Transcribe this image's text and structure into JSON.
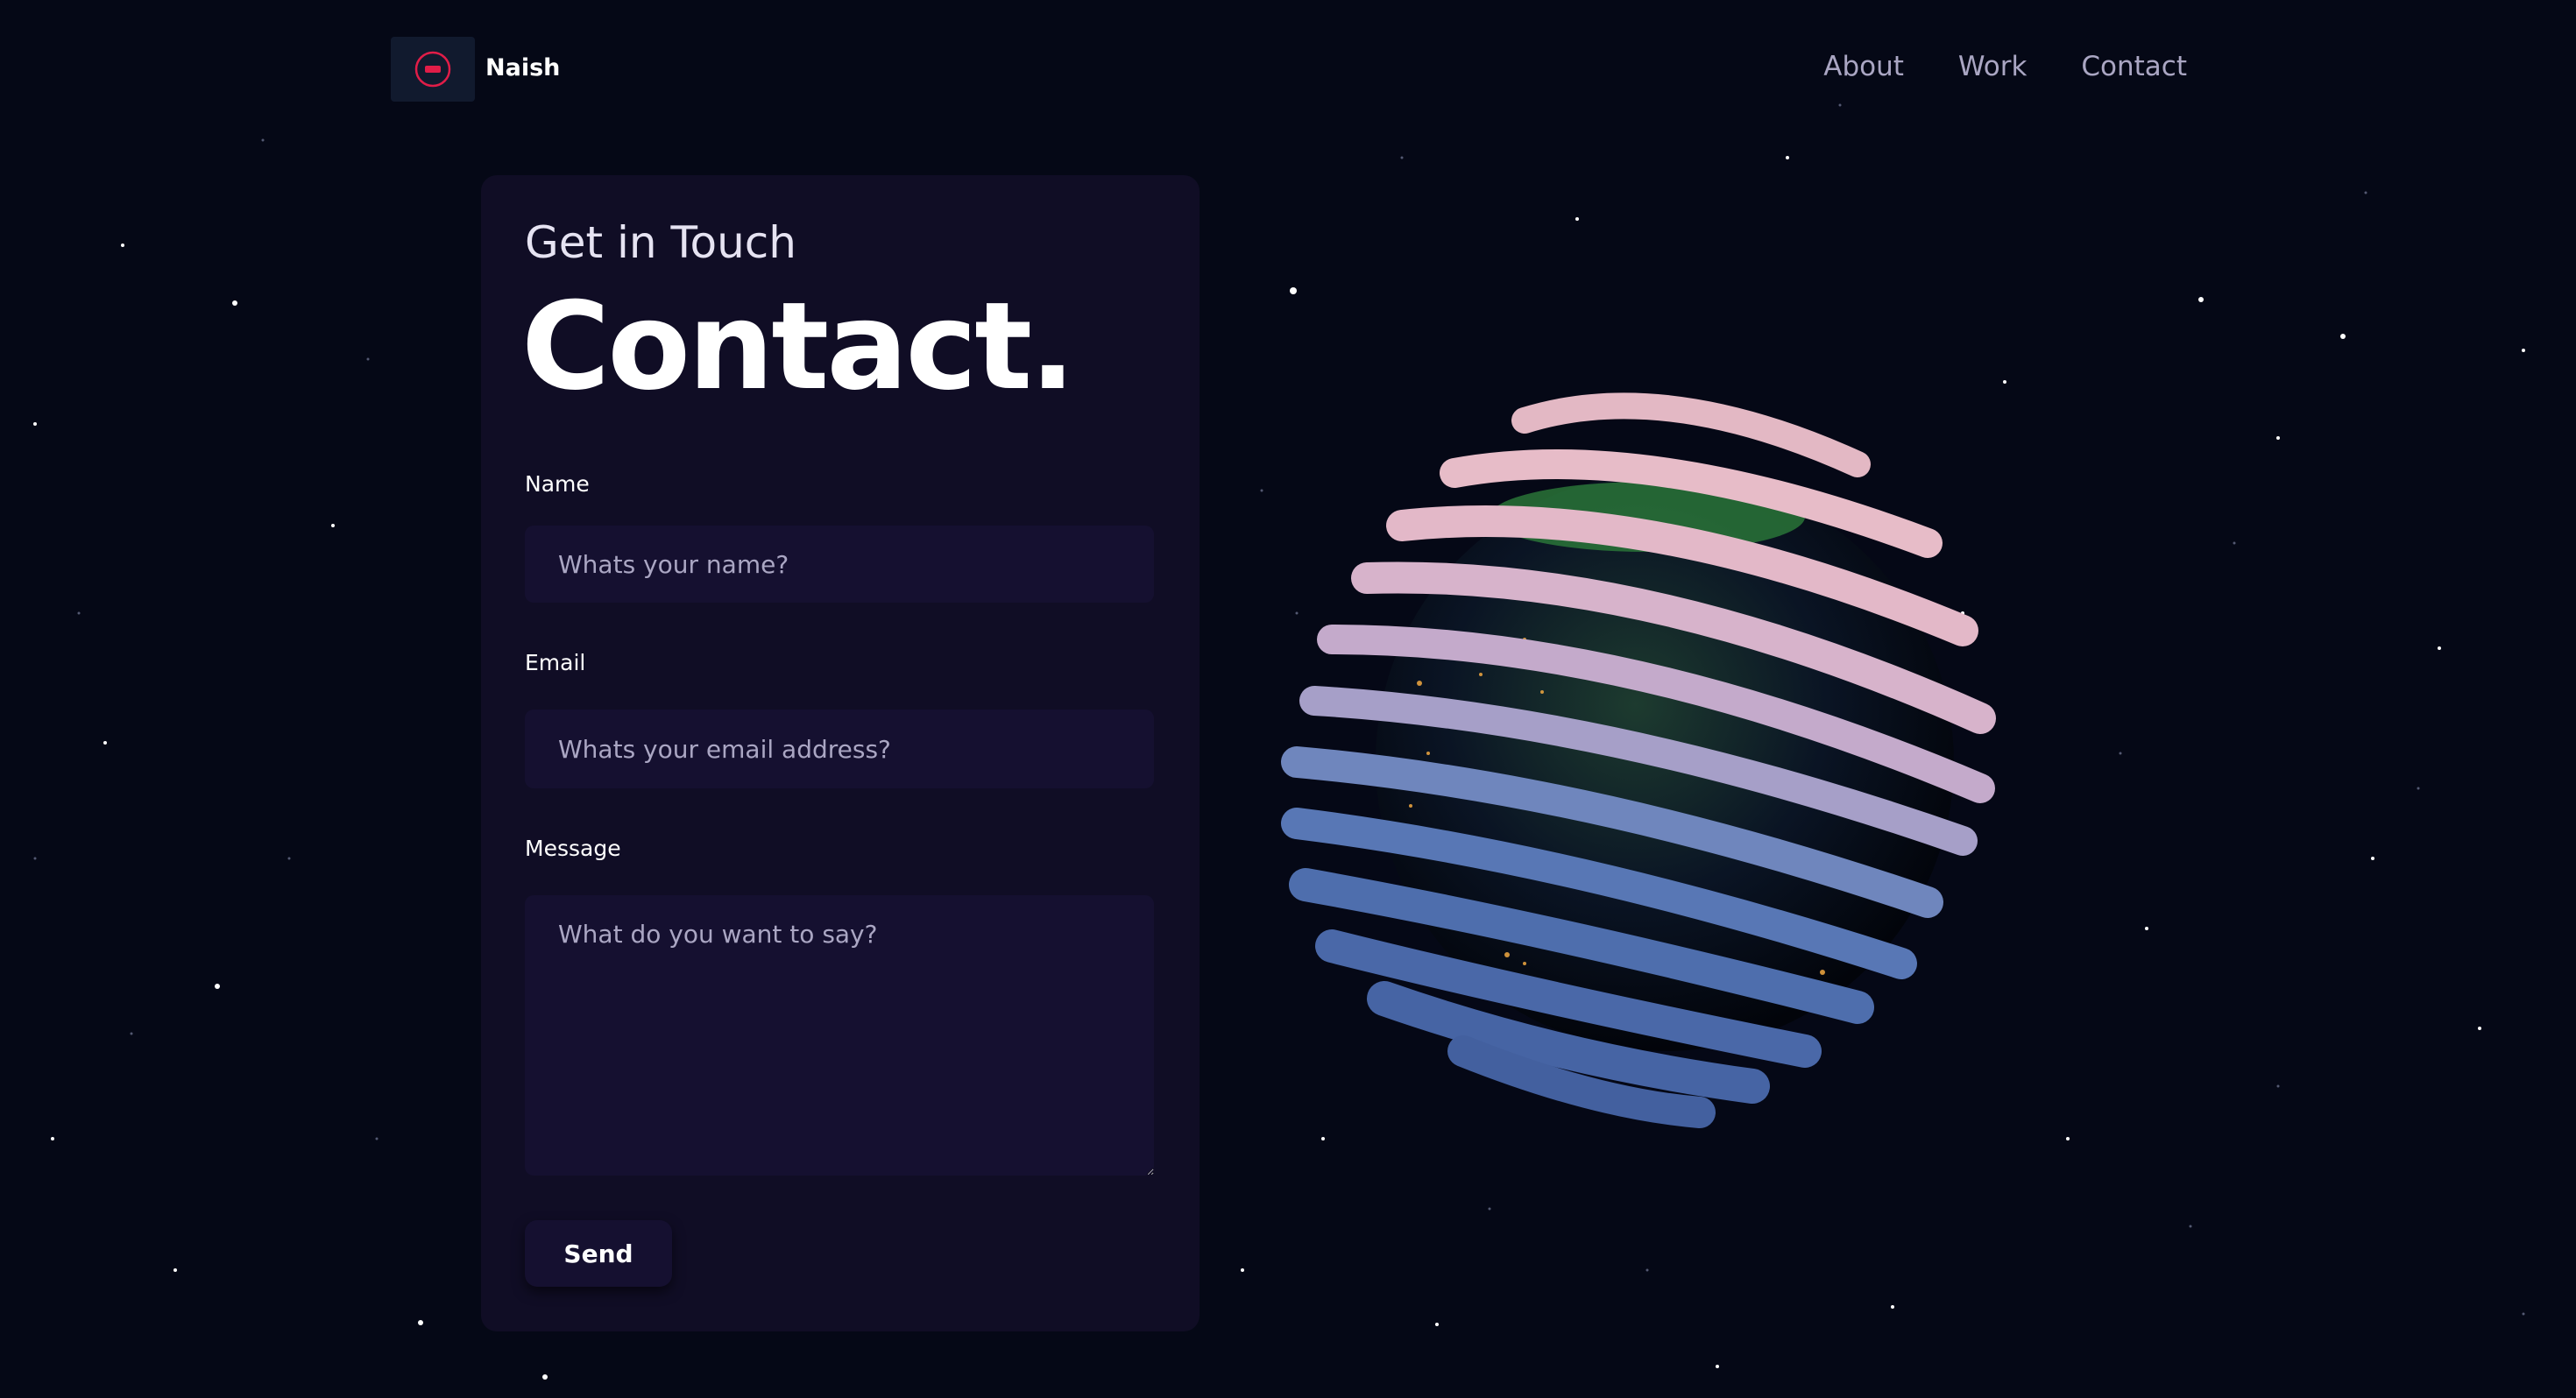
{
  "nav": {
    "brand": "Naish",
    "logo_icon": "logo-icon",
    "links": [
      "About",
      "Work",
      "Contact"
    ]
  },
  "contact": {
    "subtitle": "Get in Touch",
    "headline": "Contact.",
    "name_label": "Name",
    "name_placeholder": "Whats your name?",
    "email_label": "Email",
    "email_placeholder": "Whats your email address?",
    "message_label": "Message",
    "message_placeholder": "What do you want to say?",
    "send_label": "Send"
  },
  "colors": {
    "background": "#050816",
    "card": "#100d25",
    "input": "#151030",
    "secondary_text": "#aaa6c3",
    "accent": "#e11d48"
  }
}
